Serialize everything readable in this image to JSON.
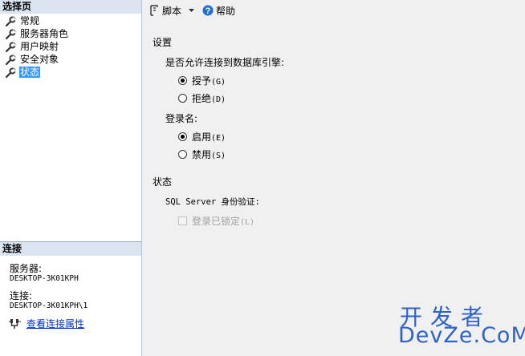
{
  "left_panel": {
    "pages_header": "选择页",
    "pages": [
      {
        "label": "常规",
        "selected": false
      },
      {
        "label": "服务器角色",
        "selected": false
      },
      {
        "label": "用户映射",
        "selected": false
      },
      {
        "label": "安全对象",
        "selected": false
      },
      {
        "label": "状态",
        "selected": true
      }
    ],
    "connection_header": "连接",
    "server_label": "服务器:",
    "server_value": "DESKTOP-3K01KPH",
    "connection_label": "连接:",
    "connection_value": "DESKTOP-3K01KPH\\1",
    "view_properties_link": "查看连接属性"
  },
  "toolbar": {
    "script_label": "脚本",
    "help_label": "帮助"
  },
  "settings": {
    "title": "设置",
    "permission_label": "是否允许连接到数据库引擎:",
    "grant_label": "授予",
    "grant_key": "(G)",
    "deny_label": "拒绝",
    "deny_key": "(D)",
    "login_label": "登录名:",
    "enabled_label": "启用",
    "enabled_key": "(E)",
    "disabled_label": "禁用",
    "disabled_key": "(S)"
  },
  "status": {
    "title": "状态",
    "auth_label": "SQL Server 身份验证:",
    "locked_label": "登录已锁定",
    "locked_key": "(L)"
  },
  "watermark": {
    "cn": "开发者",
    "en": "DevZe.CoM"
  },
  "colors": {
    "header_bg": "#dbe4f1",
    "selection": "#3399ff",
    "link": "#0033cc",
    "watermark": "#2f62c9"
  }
}
